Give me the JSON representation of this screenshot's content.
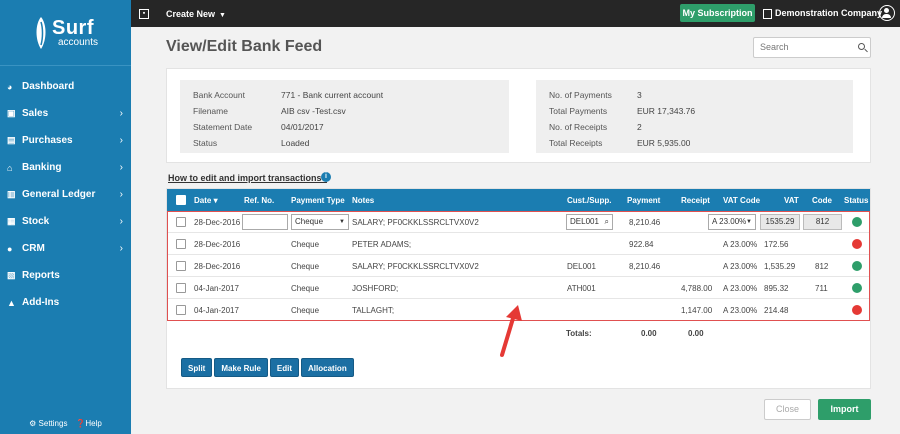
{
  "brand": {
    "name": "Surf",
    "sub": "accounts"
  },
  "sidebar": {
    "items": [
      {
        "label": "Dashboard",
        "icon": "dashboard-icon",
        "chevron": false
      },
      {
        "label": "Sales",
        "icon": "sales-icon",
        "chevron": true
      },
      {
        "label": "Purchases",
        "icon": "purchases-icon",
        "chevron": true
      },
      {
        "label": "Banking",
        "icon": "bank-icon",
        "chevron": true
      },
      {
        "label": "General Ledger",
        "icon": "ledger-icon",
        "chevron": true
      },
      {
        "label": "Stock",
        "icon": "stock-icon",
        "chevron": true
      },
      {
        "label": "CRM",
        "icon": "crm-icon",
        "chevron": true
      },
      {
        "label": "Reports",
        "icon": "reports-icon",
        "chevron": false
      },
      {
        "label": "Add-Ins",
        "icon": "add-ins-icon",
        "chevron": false
      }
    ],
    "settings": "Settings",
    "help": "Help"
  },
  "topbar": {
    "create_new": "Create New",
    "subscription": "My Subscription",
    "company": "Demonstration Company"
  },
  "page": {
    "title": "View/Edit Bank Feed",
    "search_placeholder": "Search"
  },
  "summary_left": [
    {
      "label": "Bank Account",
      "value": "771 - Bank current account"
    },
    {
      "label": "Filename",
      "value": "AIB csv -Test.csv"
    },
    {
      "label": "Statement Date",
      "value": "04/01/2017"
    },
    {
      "label": "Status",
      "value": "Loaded"
    }
  ],
  "summary_right": [
    {
      "label": "No. of Payments",
      "value": "3"
    },
    {
      "label": "Total Payments",
      "value": "EUR 17,343.76"
    },
    {
      "label": "No. of Receipts",
      "value": "2"
    },
    {
      "label": "Total Receipts",
      "value": "EUR 5,935.00"
    }
  ],
  "help_link": "How to edit and import transactions?",
  "grid": {
    "headers": {
      "date": "Date",
      "ref": "Ref. No.",
      "payment_type": "Payment Type",
      "notes": "Notes",
      "cust": "Cust./Supp.",
      "payment": "Payment",
      "receipt": "Receipt",
      "vat_code": "VAT Code",
      "vat": "VAT",
      "code": "Code",
      "status": "Status"
    },
    "rows": [
      {
        "date": "28-Dec-2016",
        "ref": "",
        "payment_type": "Cheque",
        "notes": "SALARY; PF0CKKLSSRCLTVX0V2",
        "cust": "DEL001",
        "payment": "8,210.46",
        "receipt": "",
        "vat_code": "A 23.00%",
        "vat": "1535.29",
        "code": "812",
        "status": "green"
      },
      {
        "date": "28-Dec-2016",
        "ref": "",
        "payment_type": "Cheque",
        "notes": "PETER ADAMS;",
        "cust": "",
        "payment": "922.84",
        "receipt": "",
        "vat_code": "A 23.00%",
        "vat": "172.56",
        "code": "",
        "status": "red"
      },
      {
        "date": "28-Dec-2016",
        "ref": "",
        "payment_type": "Cheque",
        "notes": "SALARY; PF0CKKLSSRCLTVX0V2",
        "cust": "DEL001",
        "payment": "8,210.46",
        "receipt": "",
        "vat_code": "A 23.00%",
        "vat": "1,535.29",
        "code": "812",
        "status": "green"
      },
      {
        "date": "04-Jan-2017",
        "ref": "",
        "payment_type": "Cheque",
        "notes": "JOSHFORD;",
        "cust": "ATH001",
        "payment": "",
        "receipt": "4,788.00",
        "vat_code": "A 23.00%",
        "vat": "895.32",
        "code": "711",
        "status": "green"
      },
      {
        "date": "04-Jan-2017",
        "ref": "",
        "payment_type": "Cheque",
        "notes": "TALLAGHT;",
        "cust": "",
        "payment": "",
        "receipt": "1,147.00",
        "vat_code": "A 23.00%",
        "vat": "214.48",
        "code": "",
        "status": "red"
      }
    ],
    "totals": {
      "label": "Totals:",
      "payment": "0.00",
      "receipt": "0.00"
    }
  },
  "actions": {
    "split": "Split",
    "make_rule": "Make Rule",
    "edit": "Edit",
    "allocation": "Allocation"
  },
  "footer": {
    "close": "Close",
    "import": "Import"
  },
  "colors": {
    "primary": "#1b7db1",
    "success": "#2e9e6a",
    "danger": "#e53935",
    "topbar": "#262626"
  }
}
